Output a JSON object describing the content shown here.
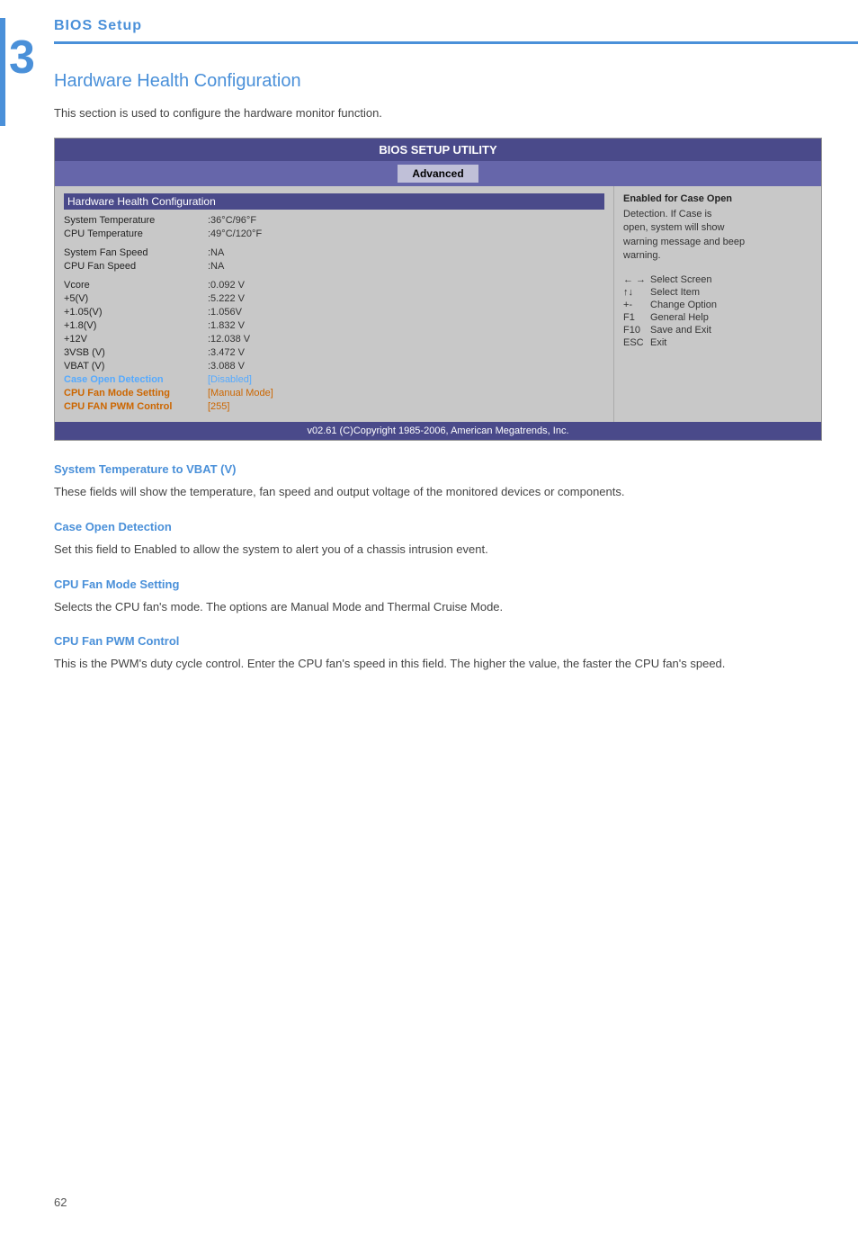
{
  "chapter": {
    "number": "3",
    "header_title": "BIOS Setup"
  },
  "page": {
    "title": "Hardware Health Configuration",
    "intro": "This section is used to configure the hardware monitor function.",
    "page_number": "62"
  },
  "bios_utility": {
    "title": "BIOS SETUP UTILITY",
    "tab": "Advanced",
    "item_header": "Hardware Health Configuration",
    "rows": [
      {
        "label": "System Temperature",
        "value": ":36°C/96°F",
        "style": "normal"
      },
      {
        "label": "CPU Temperature",
        "value": ":49°C/120°F",
        "style": "normal"
      },
      {
        "label": "",
        "value": "",
        "style": "spacer"
      },
      {
        "label": "System Fan Speed",
        "value": ":NA",
        "style": "normal"
      },
      {
        "label": "CPU Fan Speed",
        "value": ":NA",
        "style": "normal"
      },
      {
        "label": "",
        "value": "",
        "style": "spacer"
      },
      {
        "label": "Vcore",
        "value": ":0.092 V",
        "style": "normal"
      },
      {
        "label": "+5(V)",
        "value": ":5.222 V",
        "style": "normal"
      },
      {
        "label": "+1.05(V)",
        "value": ":1.056V",
        "style": "normal"
      },
      {
        "label": "+1.8(V)",
        "value": ":1.832 V",
        "style": "normal"
      },
      {
        "label": "+12V",
        "value": ":12.038 V",
        "style": "normal"
      },
      {
        "label": "3VSB (V)",
        "value": ":3.472 V",
        "style": "normal"
      },
      {
        "label": "VBAT (V)",
        "value": ":3.088 V",
        "style": "normal"
      },
      {
        "label": "Case Open Detection",
        "value": "[Disabled]",
        "style": "highlight"
      },
      {
        "label": "CPU Fan Mode Setting",
        "value": "[Manual Mode]",
        "style": "orange"
      },
      {
        "label": "CPU FAN PWM Control",
        "value": "[255]",
        "style": "orange"
      }
    ],
    "help_title": "Enabled for Case Open",
    "help_lines": [
      "Detection. If Case is",
      "open, system will show",
      "warning message and beep",
      "warning."
    ],
    "keys": [
      {
        "symbol": "← →",
        "desc": "Select Screen"
      },
      {
        "symbol": "↑↓",
        "desc": "Select Item"
      },
      {
        "symbol": "+-",
        "desc": "Change Option"
      },
      {
        "symbol": "F1",
        "desc": "General Help"
      },
      {
        "symbol": "F10",
        "desc": "Save and Exit"
      },
      {
        "symbol": "ESC",
        "desc": "Exit"
      }
    ],
    "footer": "v02.61 (C)Copyright 1985-2006, American Megatrends, Inc."
  },
  "subsections": [
    {
      "id": "sys-temp-vbat",
      "heading": "System Temperature to VBAT (V)",
      "text": "These fields will show the temperature, fan speed and output voltage of the monitored devices or components."
    },
    {
      "id": "case-open",
      "heading": "Case Open Detection",
      "text": "Set this field to Enabled to allow the system to alert you of a chassis intrusion event."
    },
    {
      "id": "cpu-fan-mode",
      "heading": "CPU Fan Mode Setting",
      "text": "Selects the CPU fan's mode. The options are Manual Mode and Thermal Cruise Mode."
    },
    {
      "id": "cpu-fan-pwm",
      "heading": "CPU Fan PWM Control",
      "text": "This is the PWM's duty cycle control. Enter the CPU fan's speed in this field. The higher the value, the faster the CPU fan's speed."
    }
  ]
}
